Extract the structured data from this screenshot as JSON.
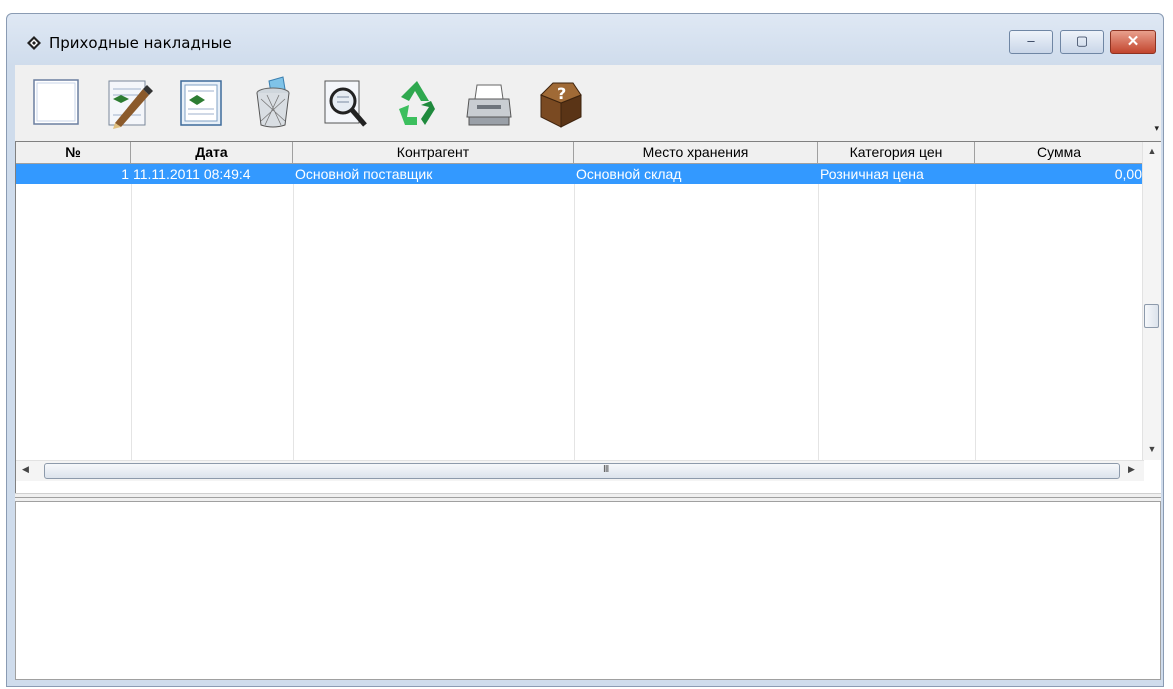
{
  "window": {
    "title": "Приходные накладные",
    "controls": {
      "minimize": "–",
      "maximize": "▢",
      "close": "✕"
    }
  },
  "toolbar": {
    "buttons": [
      {
        "name": "new-document-button",
        "icon": "blank-document-icon"
      },
      {
        "name": "edit-document-button",
        "icon": "document-pencil-icon"
      },
      {
        "name": "copy-document-button",
        "icon": "document-copy-icon"
      },
      {
        "name": "delete-button",
        "icon": "recycle-bin-icon"
      },
      {
        "name": "search-button",
        "icon": "magnifier-icon"
      },
      {
        "name": "refresh-button",
        "icon": "recycle-arrows-icon"
      },
      {
        "name": "print-button",
        "icon": "printer-icon"
      },
      {
        "name": "help-button",
        "icon": "box-question-icon"
      }
    ],
    "overflow": "▾"
  },
  "table": {
    "columns": [
      "№",
      "Дата",
      "Контрагент",
      "Место хранения",
      "Категория цен",
      "Сумма"
    ],
    "rows": [
      {
        "num": "1",
        "date": "11.11.2011 08:49:4",
        "counterparty": "Основной поставщик",
        "storage": "Основной склад",
        "price_category": "Розничная цена",
        "sum": "0,00"
      }
    ],
    "selected_row_color": "#3399ff"
  },
  "scrollbars": {
    "up": "▲",
    "down": "▼",
    "left": "◀",
    "right": "▶",
    "grip": "III"
  }
}
